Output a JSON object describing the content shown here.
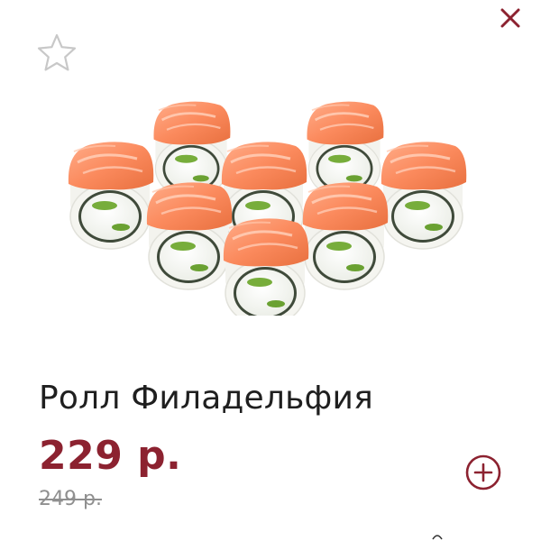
{
  "product": {
    "title": "Ролл Филадельфия",
    "price": "229 р.",
    "old_price": "249 р."
  },
  "icons": {
    "close": "close-icon",
    "favorite": "star-outline-icon",
    "add": "plus-circle-icon"
  },
  "colors": {
    "accent": "#8c2230",
    "text": "#1f1f1f",
    "muted": "#8f8f8f",
    "icon_gray": "#c8c8c8"
  }
}
